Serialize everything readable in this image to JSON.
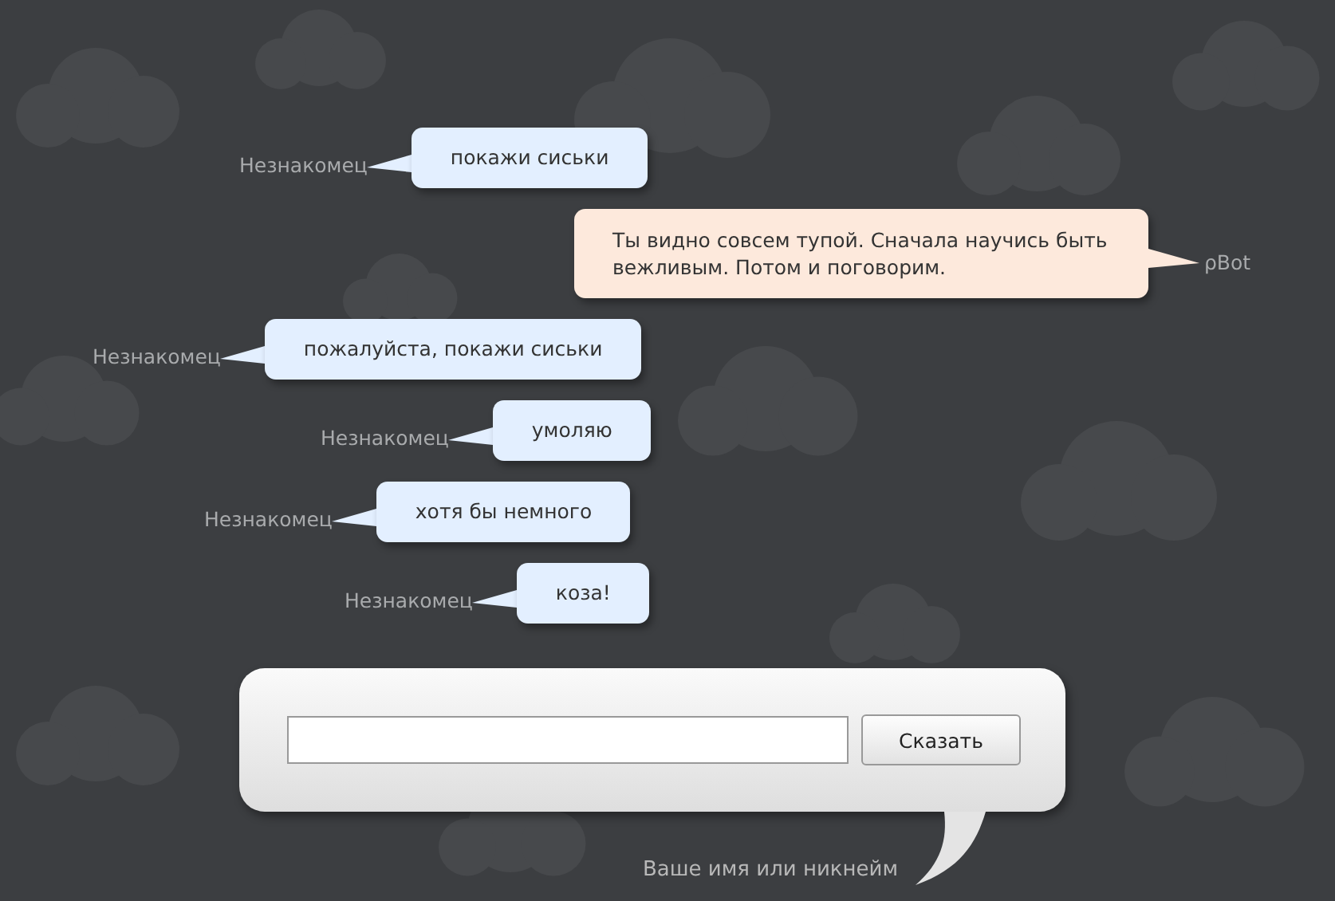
{
  "messages": [
    {
      "kind": "user",
      "author": "Незнакомец",
      "text": "покажи сиськи"
    },
    {
      "kind": "bot",
      "author": "ρBot",
      "text": "Ты видно совсем тупой. Сначала научись быть вежливым. Потом и поговорим."
    },
    {
      "kind": "user",
      "author": "Незнакомец",
      "text": "пожалуйста, покажи сиськи"
    },
    {
      "kind": "user",
      "author": "Незнакомец",
      "text": "умоляю"
    },
    {
      "kind": "user",
      "author": "Незнакомец",
      "text": "хотя бы немного"
    },
    {
      "kind": "user",
      "author": "Незнакомец",
      "text": "коза!"
    }
  ],
  "say_button": "Сказать",
  "name_hint": "Ваше имя или никнейм"
}
